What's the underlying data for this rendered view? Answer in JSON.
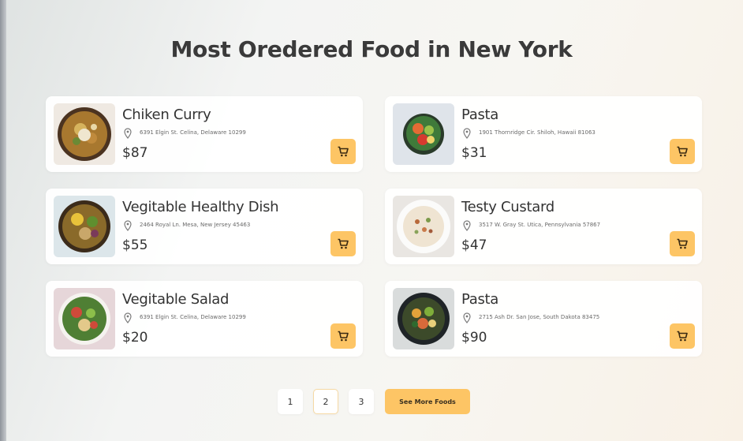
{
  "title": "Most Oredered Food in New York",
  "colors": {
    "accent": "#fdc565",
    "card_bg": "#ffffff",
    "text": "#333333"
  },
  "items": [
    {
      "name": "Chiken Curry",
      "address": "6391 Elgin St. Celina, Delaware 10299",
      "price": "$87",
      "image": "curry-bowl"
    },
    {
      "name": "Pasta",
      "address": "1901 Thornridge Cir. Shiloh, Hawaii 81063",
      "price": "$31",
      "image": "pasta-salad-bowl"
    },
    {
      "name": "Vegitable Healthy Dish",
      "address": "2464 Royal Ln. Mesa, New Jersey 45463",
      "price": "$55",
      "image": "healthy-dish-bowl"
    },
    {
      "name": "Testy Custard",
      "address": "3517 W. Gray St. Utica, Pennsylvania 57867",
      "price": "$47",
      "image": "custard-bowl"
    },
    {
      "name": "Vegitable Salad",
      "address": "6391 Elgin St. Celina, Delaware 10299",
      "price": "$20",
      "image": "salad-bowl"
    },
    {
      "name": "Pasta",
      "address": "2715 Ash Dr. San Jose, South Dakota 83475",
      "price": "$90",
      "image": "pasta-dark-bowl"
    }
  ],
  "pagination": {
    "pages": [
      "1",
      "2",
      "3"
    ],
    "active": "2",
    "more_label": "See More Foods"
  },
  "icons": {
    "location": "location-pin-icon",
    "cart": "cart-icon"
  }
}
